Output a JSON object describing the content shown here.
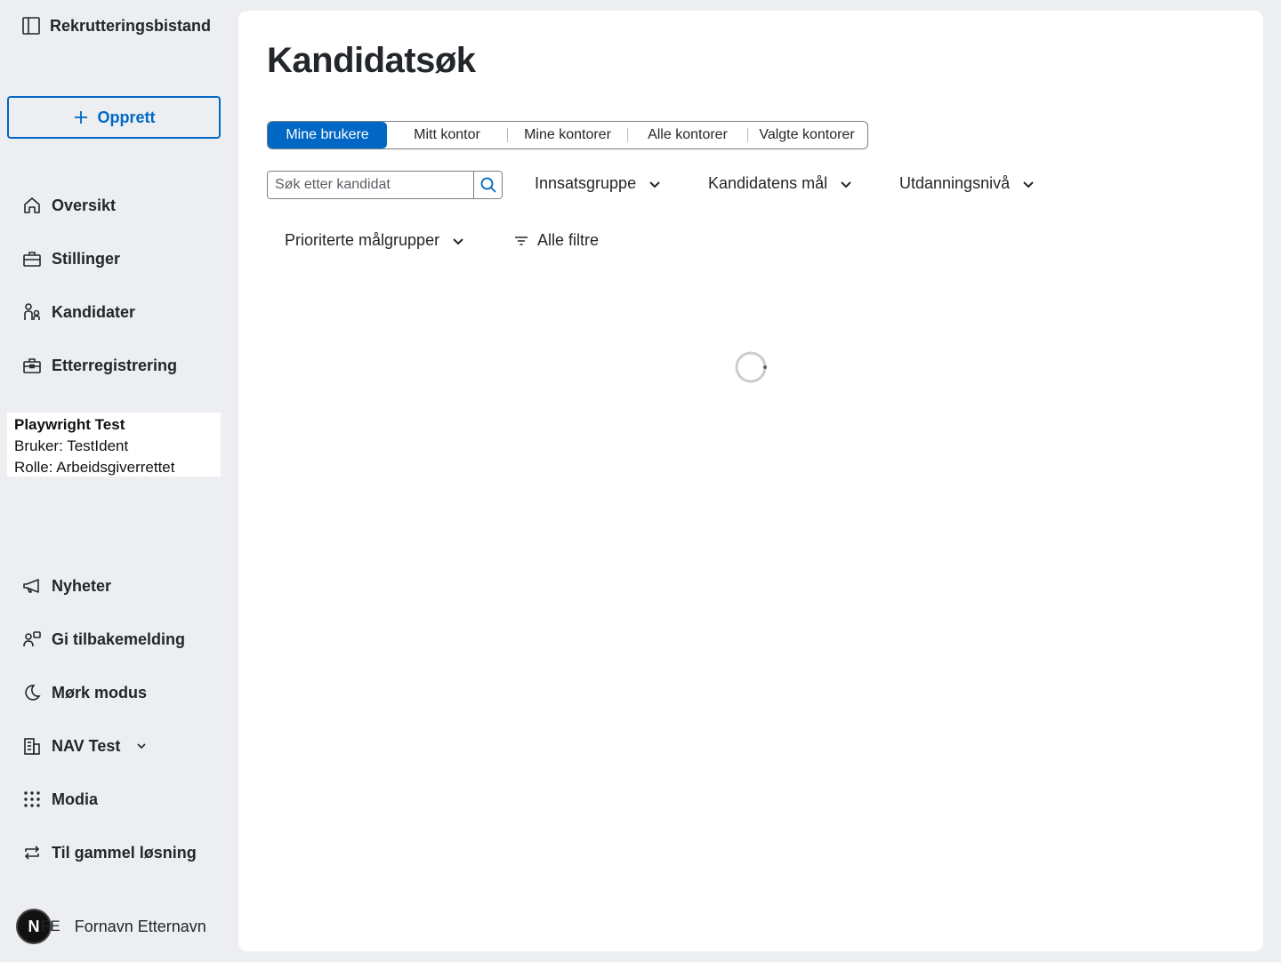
{
  "sidebar": {
    "brand": "Rekrutteringsbistand",
    "create_label": "Opprett",
    "nav_top": [
      {
        "label": "Oversikt",
        "icon": "house-icon"
      },
      {
        "label": "Stillinger",
        "icon": "briefcase-icon"
      },
      {
        "label": "Kandidater",
        "icon": "people-icon"
      },
      {
        "label": "Etterregistrering",
        "icon": "briefcase-plus-icon"
      }
    ],
    "test_box": {
      "name": "Playwright Test",
      "user": "Bruker: TestIdent",
      "role": "Rolle: Arbeidsgiverrettet"
    },
    "nav_bottom": [
      {
        "label": "Nyheter",
        "icon": "megaphone-icon"
      },
      {
        "label": "Gi tilbakemelding",
        "icon": "feedback-icon"
      },
      {
        "label": "Mørk modus",
        "icon": "moon-icon"
      },
      {
        "label": "NAV Test",
        "icon": "building-icon"
      },
      {
        "label": "Modia",
        "icon": "grid-dots-icon"
      },
      {
        "label": "Til gammel løsning",
        "icon": "arrows-cycle-icon"
      }
    ],
    "user": {
      "avatar_letter": "N",
      "initials": "FE",
      "name": "Fornavn Etternavn"
    }
  },
  "main": {
    "title": "Kandidatsøk",
    "toggles": [
      "Mine brukere",
      "Mitt kontor",
      "Mine kontorer",
      "Alle kontorer",
      "Valgte kontorer"
    ],
    "active_toggle": "Mine brukere",
    "search": {
      "placeholder": "Søk etter kandidat",
      "value": ""
    },
    "filters": [
      "Innsatsgruppe",
      "Kandidatens mål",
      "Utdanningsnivå",
      "Prioriterte målgrupper"
    ],
    "all_filters": "Alle filtre"
  },
  "colors": {
    "accent": "#0067c5",
    "sidebar_bg": "#eceef1",
    "text": "#23262a"
  }
}
